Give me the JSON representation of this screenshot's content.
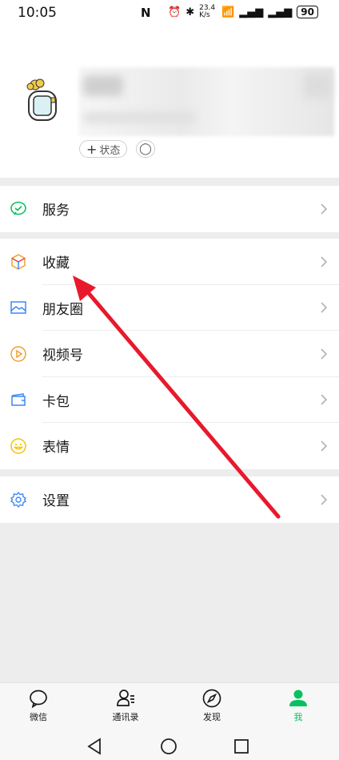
{
  "status_bar": {
    "time": "10:05",
    "nfc": "N",
    "net_speed": "23.4 K/s",
    "battery": "90"
  },
  "profile": {
    "status_button_label": "状态",
    "status_button_plus": "+",
    "refresh_glyph": "◯"
  },
  "groups": [
    {
      "items": [
        {
          "label": "服务",
          "icon": "wechat-pay-icon"
        }
      ]
    },
    {
      "items": [
        {
          "label": "收藏",
          "icon": "favorites-cube-icon"
        },
        {
          "label": "朋友圈",
          "icon": "moments-picture-icon"
        },
        {
          "label": "视频号",
          "icon": "channels-play-icon"
        },
        {
          "label": "卡包",
          "icon": "card-wallet-icon"
        },
        {
          "label": "表情",
          "icon": "emoji-smile-icon"
        }
      ]
    },
    {
      "items": [
        {
          "label": "设置",
          "icon": "settings-gear-icon"
        }
      ]
    }
  ],
  "bottom_nav": {
    "tabs": [
      {
        "label": "微信",
        "icon": "chat-bubble-icon"
      },
      {
        "label": "通讯录",
        "icon": "contacts-icon"
      },
      {
        "label": "发现",
        "icon": "compass-icon"
      },
      {
        "label": "我",
        "icon": "person-icon",
        "active": true
      }
    ]
  },
  "colors": {
    "accent_green": "#07c160",
    "annotation_red": "#e8192c",
    "background": "#ededed"
  }
}
